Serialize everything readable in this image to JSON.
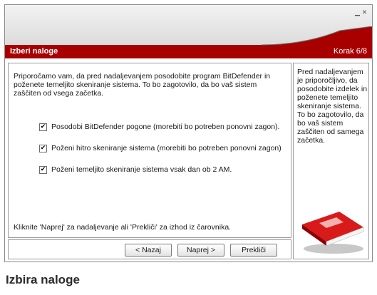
{
  "window": {
    "controls": [
      "▁",
      "✕"
    ]
  },
  "header": {
    "title": "Izberi naloge",
    "step": "Korak 6/8"
  },
  "main": {
    "intro": "Priporočamo vam, da pred nadaljevanjem posodobite program BitDefender in poženete temeljito skeniranje sistema. To bo zagotovilo, da bo vaš sistem zaščiten od vsega začetka.",
    "options": [
      {
        "label": "Posodobi BitDefender pogone (morebiti bo potreben ponovni zagon).",
        "checked": true
      },
      {
        "label": "Poženi hitro skeniranje sistema (morebiti bo potreben ponovni zagon)",
        "checked": true
      },
      {
        "label": "Poženi temeljito skeniranje sistema vsak dan ob 2 AM.",
        "checked": true
      }
    ],
    "footer": "Kliknite 'Naprej' za nadaljevanje ali 'Prekliči' za izhod iz čarovnika."
  },
  "sidebar": {
    "help": "Pred nadaljevanjem je priporočljivo, da posodobite izdelek in poženete temeljito skeniranje sistema. To bo zagotovilo, da bo vaš sistem zaščiten od samega začetka.",
    "icon": "red-book-icon"
  },
  "buttons": {
    "back": "< Nazaj",
    "next": "Naprej >",
    "cancel": "Prekliči"
  },
  "caption": "Izbira naloge",
  "colors": {
    "accent": "#b30000",
    "border": "#9a9a9a"
  }
}
